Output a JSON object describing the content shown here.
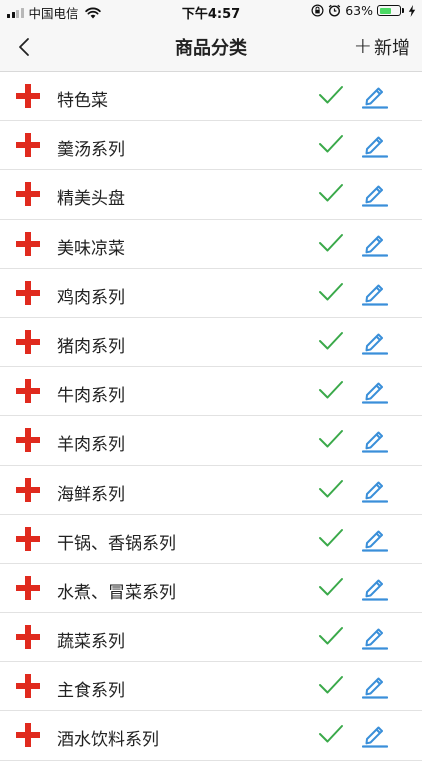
{
  "status_bar": {
    "carrier": "中国电信",
    "time": "下午4:57",
    "battery_percent_text": "63%",
    "battery_level": 0.63
  },
  "nav": {
    "title": "商品分类",
    "add_label": "新增",
    "add_symbol": "+"
  },
  "colors": {
    "plus": "#e02a1e",
    "check": "#3aa94a",
    "edit": "#3a8fd9"
  },
  "categories": [
    {
      "label": "特色菜"
    },
    {
      "label": "羹汤系列"
    },
    {
      "label": "精美头盘"
    },
    {
      "label": "美味凉菜"
    },
    {
      "label": "鸡肉系列"
    },
    {
      "label": "猪肉系列"
    },
    {
      "label": "牛肉系列"
    },
    {
      "label": "羊肉系列"
    },
    {
      "label": "海鲜系列"
    },
    {
      "label": "干锅、香锅系列"
    },
    {
      "label": "水煮、冒菜系列"
    },
    {
      "label": "蔬菜系列"
    },
    {
      "label": "主食系列"
    },
    {
      "label": "酒水饮料系列"
    }
  ]
}
